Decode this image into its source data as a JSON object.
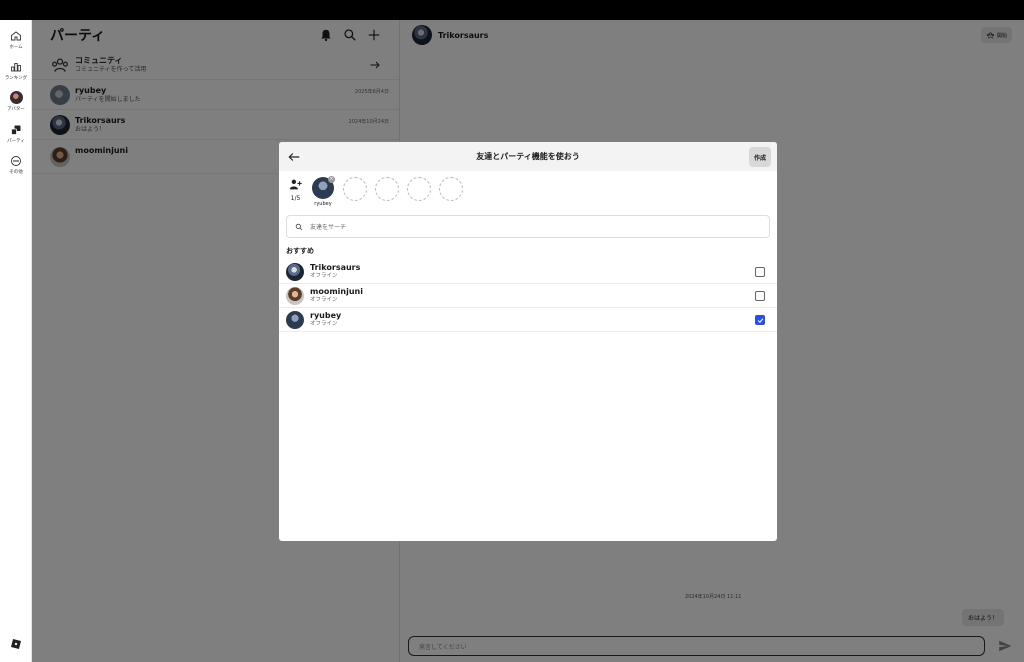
{
  "rail": {
    "items": [
      {
        "label": "ホーム",
        "icon": "home-icon"
      },
      {
        "label": "ランキング",
        "icon": "ranking-icon"
      },
      {
        "label": "アバター",
        "icon": "avatar-icon"
      },
      {
        "label": "パーティ",
        "icon": "party-icon"
      },
      {
        "label": "その他",
        "icon": "more-icon"
      }
    ]
  },
  "list": {
    "title": "パーティ",
    "community": {
      "name": "コミュニティ",
      "sub": "コミュニティを作って活用"
    },
    "chats": [
      {
        "name": "ryubey",
        "sub": "パーティを開始しました",
        "date": "2025年6月4日"
      },
      {
        "name": "Trikorsaurs",
        "sub": "おはよう！",
        "date": "2024年10月24日"
      },
      {
        "name": "moominjuni",
        "sub": "",
        "date": ""
      }
    ]
  },
  "conversation": {
    "title": "Trikorsaurs",
    "party_button": "開始",
    "timestamp": "2024年10月24日 11:11",
    "message": "おはよう！",
    "composer_placeholder": "発言してください"
  },
  "modal": {
    "title": "友達とパーティ機能を使おう",
    "create_label": "作成",
    "count": "1/5",
    "selected_name": "ryubey",
    "search_placeholder": "友達をサーチ",
    "section_label": "おすすめ",
    "friends": [
      {
        "name": "Trikorsaurs",
        "status": "オフライン",
        "checked": false
      },
      {
        "name": "moominjuni",
        "status": "オフライン",
        "checked": false
      },
      {
        "name": "ryubey",
        "status": "オフライン",
        "checked": true
      }
    ]
  },
  "colors": {
    "accent": "#2b4fe0",
    "overlay": "rgba(0,0,0,0.5)"
  }
}
